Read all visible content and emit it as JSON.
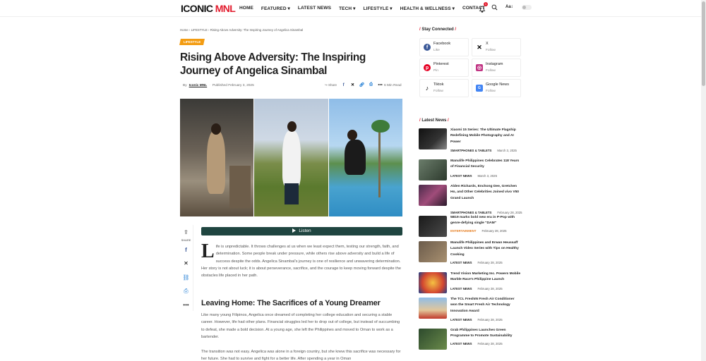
{
  "header": {
    "logo_main": "ICONIC",
    "logo_accent": " MNL",
    "nav": [
      "HOME",
      "FEATURED ▾",
      "LATEST NEWS",
      "TECH ▾",
      "LIFESTYLE ▾",
      "HEALTH & WELLNESS ▾",
      "CONTACT"
    ],
    "notification_count": "1",
    "font_size_label": "Aa↕"
  },
  "article": {
    "breadcrumb": "Home › LIFESTYLE › Rising Above Adversity: The Inspiring Journey of Angelica Sinambal",
    "category": "LIFESTYLE",
    "title": "Rising Above Adversity: The Inspiring Journey of Angelica Sinambal",
    "by": "By",
    "author": "Iconic MNL",
    "published": "Published February 3, 2025",
    "share_label": "Share",
    "read_time": "6 Min Read",
    "share_side_label": "SHARE",
    "listen_label": "Listen",
    "dropcap": "L",
    "intro": "ife is unpredictable. It throws challenges at us when we least expect them, testing our strength, faith, and determination. Some people break under pressure, while others rise above adversity and build a life of success despite the odds. Angelica Sinambal's journey is one of resilience and unwavering determination. Her story is not about luck; it is about perseverance, sacrifice, and the courage to keep moving forward despite the obstacles life placed in her path.",
    "heading": "Leaving Home: The Sacrifices of a Young Dreamer",
    "para2": "Like many young Filipinos, Angelica once dreamed of completing her college education and securing a stable career. However, life had other plans. Financial struggles led her to drop out of college, but instead of succumbing to defeat, she made a bold decision. At a young age, she left the Philippines and moved to Oman to work as a bartender.",
    "para3": "The transition was not easy. Angelica was alone in a foreign country, but she knew this sacrifice was necessary for her future. She had to survive and fight for a better life. After spending a year in Oman"
  },
  "sidebar": {
    "stay_connected": "Stay Connected",
    "socials": [
      {
        "name": "Facebook",
        "action": "Like",
        "icon": "facebook-icon",
        "color": "#3b5998"
      },
      {
        "name": "X",
        "action": "Follow",
        "icon": "x-icon",
        "color": "#000000"
      },
      {
        "name": "Pinterest",
        "action": "Pin",
        "icon": "pinterest-icon",
        "color": "#e60023"
      },
      {
        "name": "Instagram",
        "action": "Follow",
        "icon": "instagram-icon",
        "color": "#c13584"
      },
      {
        "name": "Tiktok",
        "action": "Follow",
        "icon": "tiktok-icon",
        "color": "#000000"
      },
      {
        "name": "Google News",
        "action": "Follow",
        "icon": "google-news-icon",
        "color": "#4285f4"
      }
    ],
    "latest_news": "Latest News",
    "news": [
      {
        "title": "Xiaomi 15 Series: The Ultimate Flagship Redefining Mobile Photography and AI Power",
        "cat": "SMARTPHONES & TABLETS",
        "date": "March 3, 2025"
      },
      {
        "title": "Manulife Philippines Celebrates 118 Years of Financial Security",
        "cat": "LATEST NEWS",
        "date": "March 3, 2025"
      },
      {
        "title": "Alden Richards, Enchong Dee, Gretchen Ho, and Other Celebrities Joined vivo V50 Grand Launch",
        "cat": "SMARTPHONES & TABLETS",
        "date": "February 28, 2025"
      },
      {
        "title": "5B19 marks bold new era in P-Pop with genre-defying single \"DAM\"",
        "cat": "ENTERTAINMENT",
        "date": "February 28, 2025"
      },
      {
        "title": "Manulife Philippines and Erwan Heussaff Launch Video Series with Tips on Healthy Cooking",
        "cat": "LATEST NEWS",
        "date": "February 28, 2025"
      },
      {
        "title": "Trend Vision Marketing Inc. Powers Mobile Marble Race's Philippine Launch",
        "cat": "LATEST NEWS",
        "date": "February 28, 2025"
      },
      {
        "title": "The TCL FreshIN Fresh Air Conditioner won the Smart Fresh Air Technology Innovation Award",
        "cat": "LATEST NEWS",
        "date": "February 28, 2025"
      },
      {
        "title": "Grab Philippines Launches Green Programme to Promote Sustainability",
        "cat": "LATEST NEWS",
        "date": "February 28, 2025"
      }
    ]
  }
}
